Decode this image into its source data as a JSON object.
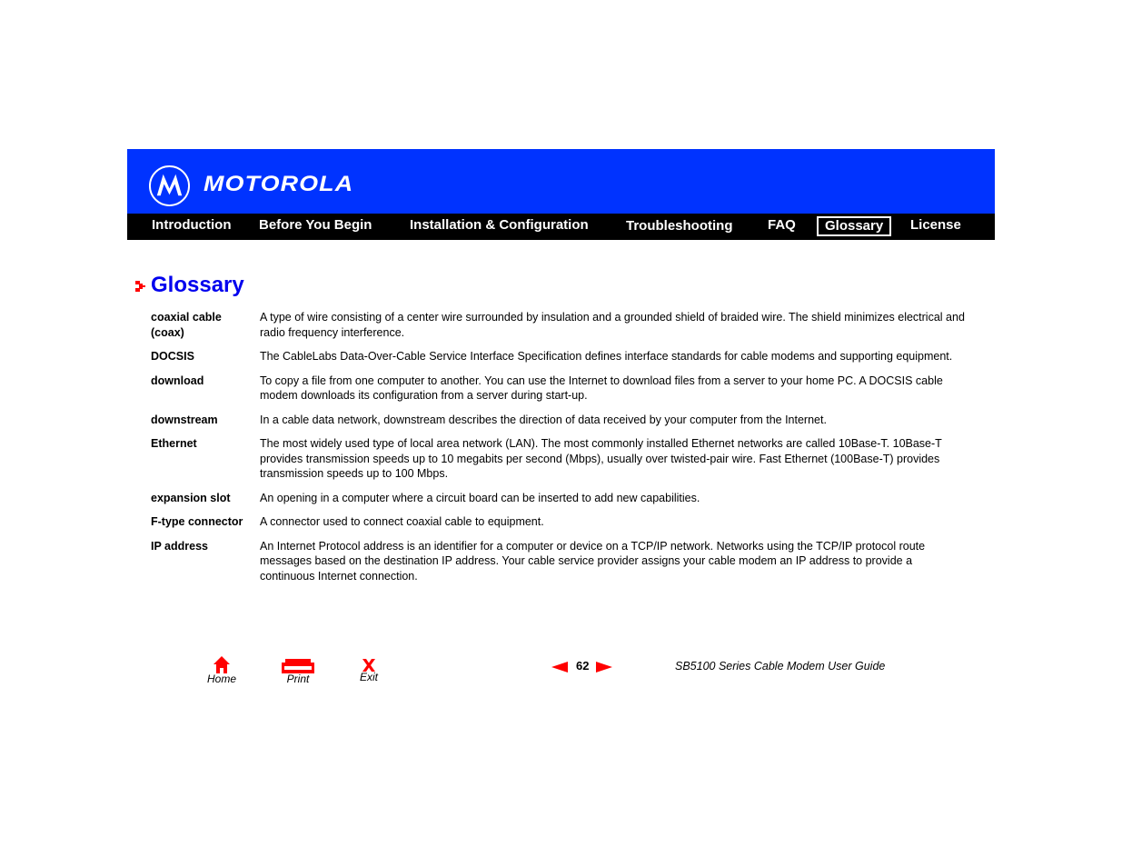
{
  "header": {
    "brand": "MOTOROLA",
    "nav": [
      {
        "label": "Introduction",
        "active": false
      },
      {
        "label": "Before You Begin",
        "active": false
      },
      {
        "label": "Installation & Configuration",
        "active": false
      },
      {
        "label": "Troubleshooting",
        "active": false
      },
      {
        "label": "FAQ",
        "active": false
      },
      {
        "label": "Glossary",
        "active": true
      },
      {
        "label": "License",
        "active": false
      }
    ]
  },
  "page": {
    "title": "Glossary",
    "entries": [
      {
        "term": "coaxial cable (coax)",
        "definition": "A type of wire consisting of a center wire surrounded by insulation and a grounded shield of braided wire. The shield minimizes electrical and radio frequency interference."
      },
      {
        "term": "DOCSIS",
        "definition": "The CableLabs Data-Over-Cable Service Interface Specification defines interface standards for cable modems and supporting equipment."
      },
      {
        "term": "download",
        "definition": "To copy a file from one computer to another. You can use the Internet to download files from a server to your home PC. A DOCSIS cable modem downloads its configuration from a server during start-up."
      },
      {
        "term": "downstream",
        "definition": "In a cable data network, downstream describes the direction of data received by your computer from the Internet."
      },
      {
        "term": "Ethernet",
        "definition": "The most widely used type of local area network (LAN). The most commonly installed Ethernet networks are called 10Base-T. 10Base-T provides transmission speeds up to 10 megabits per second (Mbps), usually over twisted-pair wire. Fast Ethernet (100Base-T) provides transmission speeds up to 100 Mbps."
      },
      {
        "term": "expansion slot",
        "definition": "An opening in a computer where a circuit board can be inserted to add new capabilities."
      },
      {
        "term": "F-type connector",
        "definition": "A connector used to connect coaxial cable to equipment."
      },
      {
        "term": "IP address",
        "definition": "An Internet Protocol address is an identifier for a computer or device on a TCP/IP network. Networks using the TCP/IP protocol route messages based on the destination IP address. Your cable service provider assigns your cable modem an IP address to provide a continuous Internet connection."
      }
    ]
  },
  "footer": {
    "home_label": "Home",
    "print_label": "Print",
    "exit_label": "Exit",
    "page_number": "62",
    "guide_title": "SB5100 Series Cable Modem User Guide",
    "icons": {
      "home": "home-icon",
      "print": "print-icon",
      "exit": "exit-x-icon",
      "prev": "prev-page-arrow-icon",
      "next": "next-page-arrow-icon"
    }
  },
  "colors": {
    "banner": "#0033ff",
    "nav_bg": "#000000",
    "title": "#0000ee",
    "accent_red": "#ff0000"
  }
}
